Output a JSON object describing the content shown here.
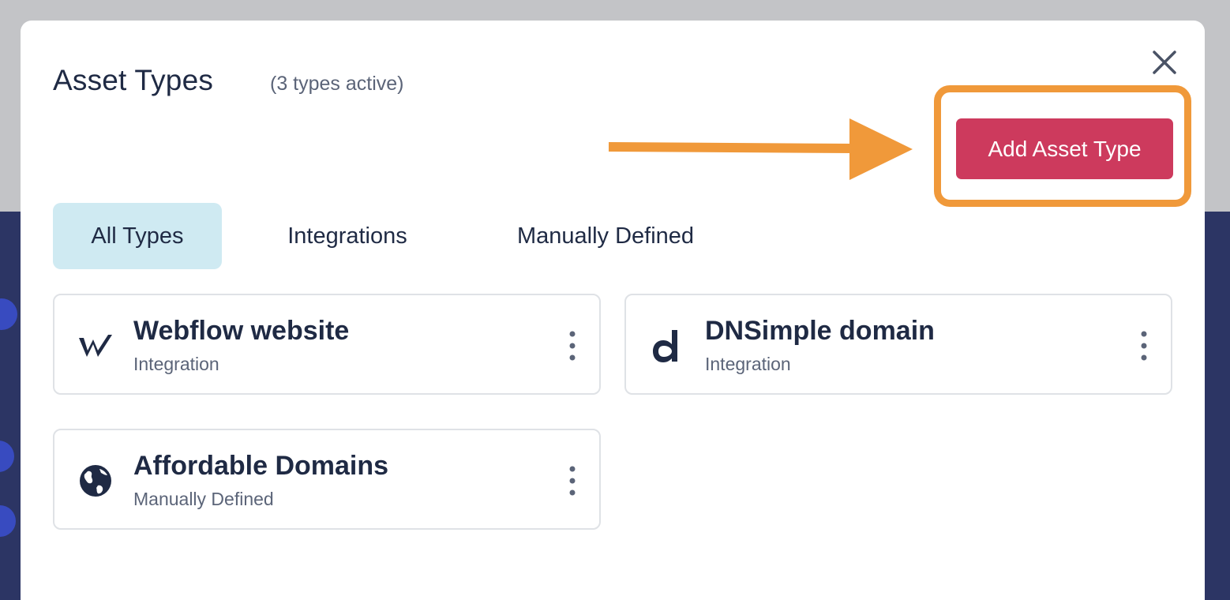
{
  "modal": {
    "title": "Asset Types",
    "count_text": "(3 types active)",
    "add_button_label": "Add Asset Type"
  },
  "tabs": [
    {
      "label": "All Types",
      "active": true
    },
    {
      "label": "Integrations",
      "active": false
    },
    {
      "label": "Manually Defined",
      "active": false
    }
  ],
  "asset_types": [
    {
      "name": "Webflow website",
      "kind": "Integration",
      "icon": "webflow-logo-icon"
    },
    {
      "name": "DNSimple domain",
      "kind": "Integration",
      "icon": "dnsimple-logo-icon"
    },
    {
      "name": "Affordable Domains",
      "kind": "Manually Defined",
      "icon": "globe-icon"
    }
  ],
  "colors": {
    "primary_button": "#cd3a5d",
    "highlight": "#f0993a",
    "active_tab": "#cfeaf2",
    "text_primary": "#1f2a44",
    "text_secondary": "#5b6478"
  }
}
